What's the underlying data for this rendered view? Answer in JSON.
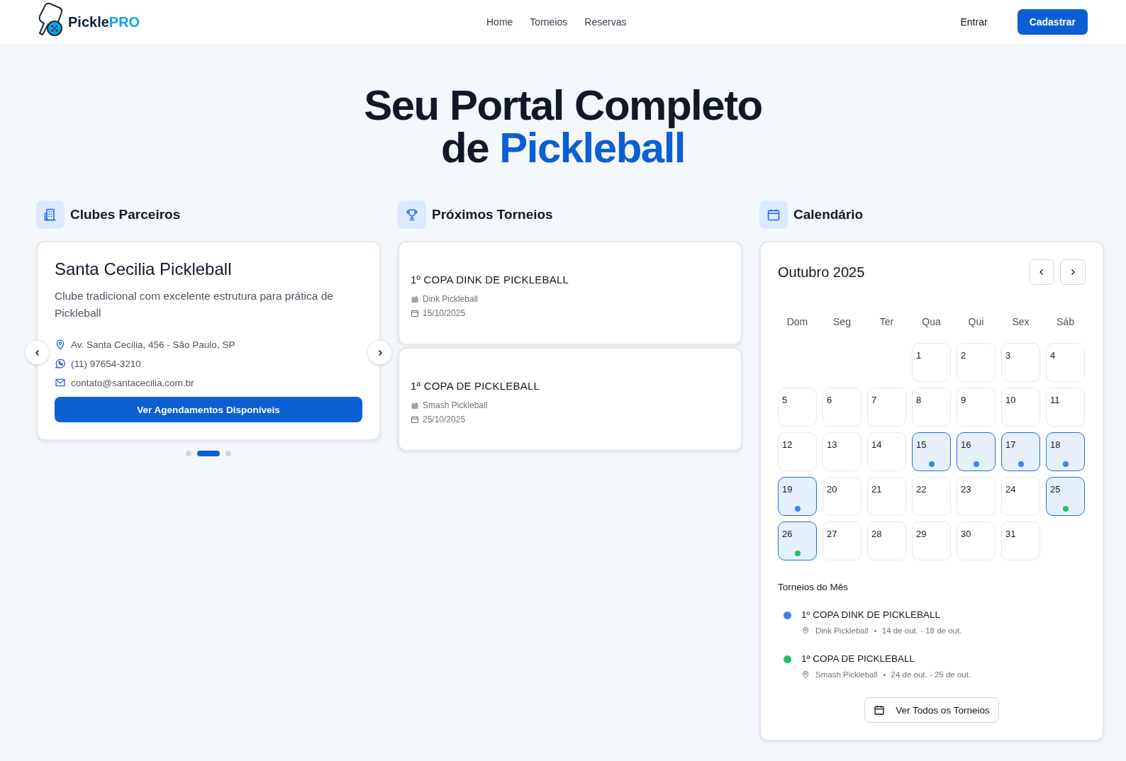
{
  "header": {
    "logo_text": "Pickle",
    "logo_accent": "PRO",
    "nav": [
      {
        "label": "Home"
      },
      {
        "label": "Torneios"
      },
      {
        "label": "Reservas"
      }
    ],
    "login": "Entrar",
    "signup": "Cadastrar"
  },
  "hero": {
    "line1": "Seu Portal Completo",
    "line2_prefix": "de",
    "line2_accent": "Pickleball"
  },
  "clubs": {
    "title": "Clubes Parceiros",
    "club": {
      "name": "Santa Cecilia Pickleball",
      "description": "Clube tradicional com excelente estrutura para prática de Pickleball",
      "address": "Av. Santa Cecilia, 456 - São Paulo, SP",
      "phone": "(11) 97654-3210",
      "email": "contato@santacecilia.com.br",
      "button": "Ver Agendamentos Disponíveis"
    },
    "dots": [
      {
        "selected": false
      },
      {
        "selected": true
      },
      {
        "selected": false
      }
    ]
  },
  "tournaments": {
    "title": "Próximos Torneios",
    "items": [
      {
        "name": "1º COPA DINK DE PICKLEBALL",
        "club": "Dink Pickleball",
        "date": "15/10/2025"
      },
      {
        "name": "1ª COPA DE PICKLEBALL",
        "club": "Smash Pickleball",
        "date": "25/10/2025"
      }
    ]
  },
  "calendar": {
    "title": "Calendário",
    "month": "Outubro 2025",
    "weekdays": [
      "Dom",
      "Seg",
      "Ter",
      "Qua",
      "Qui",
      "Sex",
      "Sáb"
    ],
    "cells": [
      {
        "kind": "blank"
      },
      {
        "kind": "blank"
      },
      {
        "kind": "blank"
      },
      {
        "kind": "day",
        "day": "1"
      },
      {
        "kind": "day",
        "day": "2"
      },
      {
        "kind": "day",
        "day": "3"
      },
      {
        "kind": "day",
        "day": "4"
      },
      {
        "kind": "day",
        "day": "5"
      },
      {
        "kind": "day",
        "day": "6"
      },
      {
        "kind": "day",
        "day": "7"
      },
      {
        "kind": "day",
        "day": "8"
      },
      {
        "kind": "day",
        "day": "9"
      },
      {
        "kind": "day",
        "day": "10"
      },
      {
        "kind": "day",
        "day": "11"
      },
      {
        "kind": "day",
        "day": "12"
      },
      {
        "kind": "day",
        "day": "13"
      },
      {
        "kind": "day",
        "day": "14"
      },
      {
        "kind": "day",
        "day": "15",
        "color": "#3b82f6"
      },
      {
        "kind": "day",
        "day": "16",
        "color": "#3b82f6"
      },
      {
        "kind": "day",
        "day": "17",
        "color": "#3b82f6"
      },
      {
        "kind": "day",
        "day": "18",
        "color": "#3b82f6"
      },
      {
        "kind": "day",
        "day": "19",
        "color": "#3b82f6"
      },
      {
        "kind": "day",
        "day": "20"
      },
      {
        "kind": "day",
        "day": "21"
      },
      {
        "kind": "day",
        "day": "22"
      },
      {
        "kind": "day",
        "day": "23"
      },
      {
        "kind": "day",
        "day": "24"
      },
      {
        "kind": "day",
        "day": "25",
        "color": "#22c55e"
      },
      {
        "kind": "day",
        "day": "26",
        "color": "#22c55e"
      },
      {
        "kind": "day",
        "day": "27"
      },
      {
        "kind": "day",
        "day": "28"
      },
      {
        "kind": "day",
        "day": "29"
      },
      {
        "kind": "day",
        "day": "30"
      },
      {
        "kind": "day",
        "day": "31"
      }
    ],
    "month_title": "Torneios do Mês",
    "events": [
      {
        "name": "1º COPA DINK DE PICKLEBALL",
        "club": "Dink Pickleball",
        "range": "14 de out. - 18 de out.",
        "color": "#3b82f6"
      },
      {
        "name": "1ª COPA DE PICKLEBALL",
        "club": "Smash Pickleball",
        "range": "24 de out. - 25 de out.",
        "color": "#22c55e"
      }
    ],
    "all_button": "Ver Todos os Torneios"
  }
}
